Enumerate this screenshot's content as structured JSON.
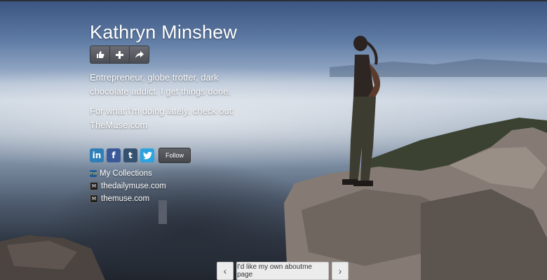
{
  "profile": {
    "name": "Kathryn Minshew",
    "bio_line1": "Entrepreneur, globe trotter, dark chocolate addict. I get things done.",
    "bio_line2_prefix": "For what I'm doing lately, check out: ",
    "bio_link": "TheMuse.com"
  },
  "actions": {
    "icons": [
      "thumbs-up-icon",
      "plus-icon",
      "share-arrow-icon"
    ]
  },
  "social": {
    "linkedin": "in",
    "facebook": "f",
    "tumblr": "t",
    "follow_label": "Follow"
  },
  "links": [
    {
      "icon": "collections-icon",
      "label": "My Collections"
    },
    {
      "icon": "m-site-icon",
      "label": "thedailymuse.com"
    },
    {
      "icon": "m-site-icon",
      "label": "themuse.com"
    }
  ],
  "pager": {
    "prev": "‹",
    "cta": "I'd like my own aboutme page",
    "next": "›"
  }
}
